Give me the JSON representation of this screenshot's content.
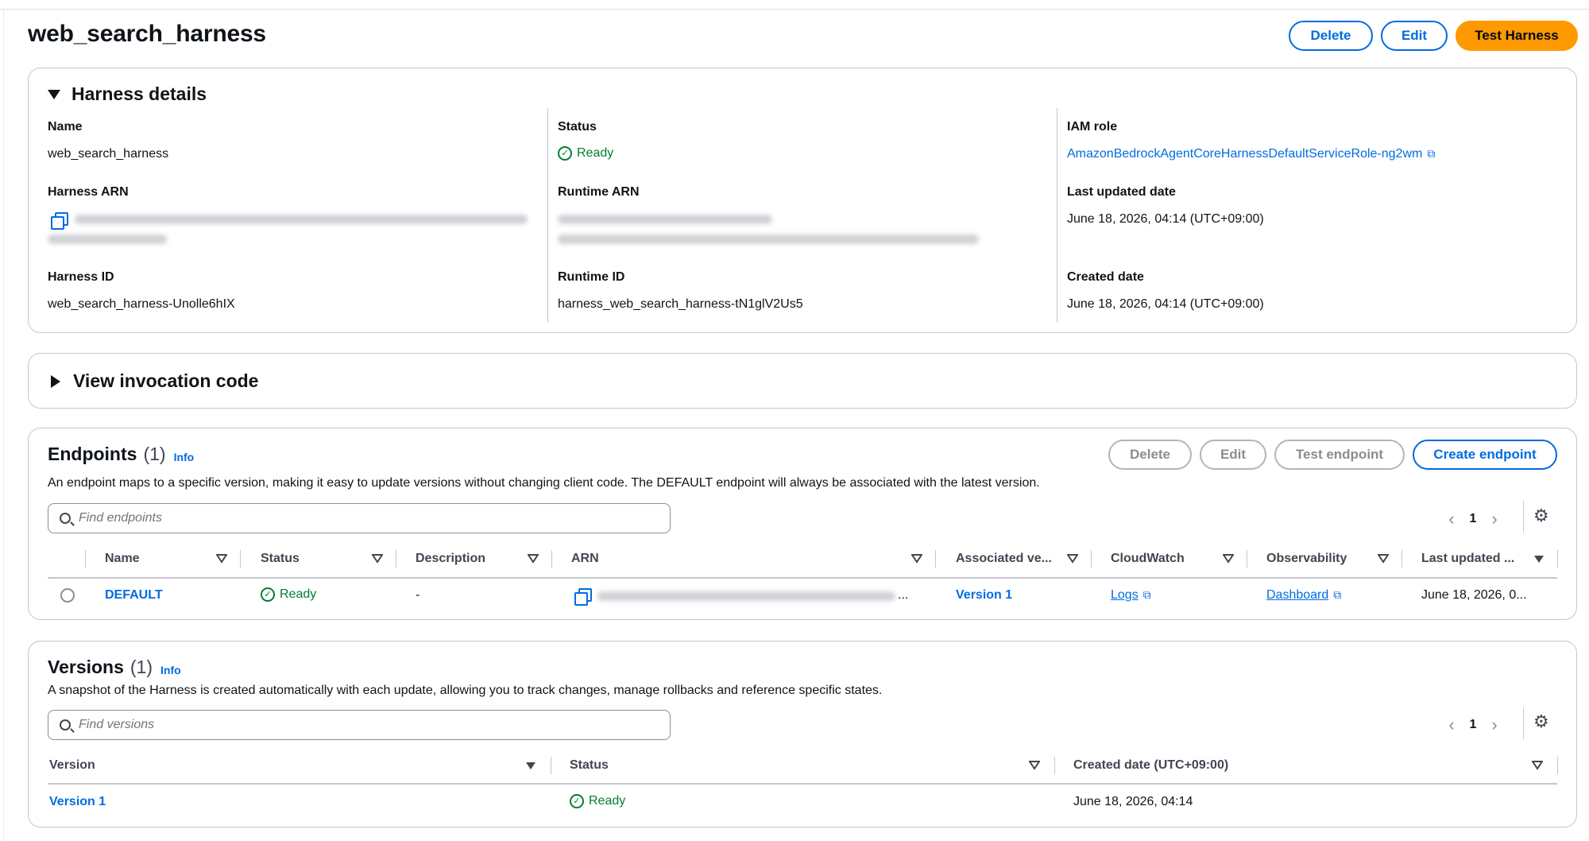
{
  "page": {
    "title": "web_search_harness",
    "buttons": {
      "delete": "Delete",
      "edit": "Edit",
      "test": "Test Harness"
    }
  },
  "details": {
    "heading": "Harness details",
    "name_label": "Name",
    "name_value": "web_search_harness",
    "status_label": "Status",
    "status_value": "Ready",
    "iam_label": "IAM role",
    "iam_value": "AmazonBedrockAgentCoreHarnessDefaultServiceRole-ng2wm",
    "harness_arn_label": "Harness ARN",
    "runtime_arn_label": "Runtime ARN",
    "last_updated_label": "Last updated date",
    "last_updated_value": "June 18, 2026, 04:14 (UTC+09:00)",
    "harness_id_label": "Harness ID",
    "harness_id_value": "web_search_harness-Unolle6hIX",
    "runtime_id_label": "Runtime ID",
    "runtime_id_value": "harness_web_search_harness-tN1glV2Us5",
    "created_label": "Created date",
    "created_value": "June 18, 2026, 04:14 (UTC+09:00)"
  },
  "invocation": {
    "heading": "View invocation code"
  },
  "endpoints": {
    "heading": "Endpoints",
    "count": "(1)",
    "info": "Info",
    "description": "An endpoint maps to a specific version, making it easy to update versions without changing client code. The DEFAULT endpoint will always be associated with the latest version.",
    "buttons": {
      "delete": "Delete",
      "edit": "Edit",
      "test": "Test endpoint",
      "create": "Create endpoint"
    },
    "search_placeholder": "Find endpoints",
    "page": "1",
    "columns": [
      "Name",
      "Status",
      "Description",
      "ARN",
      "Associated ve...",
      "CloudWatch",
      "Observability",
      "Last updated ..."
    ],
    "row": {
      "name": "DEFAULT",
      "status": "Ready",
      "description": "-",
      "arn_ellipsis": "...",
      "version": "Version 1",
      "cloudwatch": "Logs",
      "observability": "Dashboard",
      "last_updated": "June 18, 2026, 0..."
    }
  },
  "versions": {
    "heading": "Versions",
    "count": "(1)",
    "info": "Info",
    "description": "A snapshot of the Harness is created automatically with each update, allowing you to track changes, manage rollbacks and reference specific states.",
    "search_placeholder": "Find versions",
    "page": "1",
    "columns": [
      "Version",
      "Status",
      "Created date (UTC+09:00)"
    ],
    "row": {
      "version": "Version 1",
      "status": "Ready",
      "created": "June 18, 2026, 04:14"
    }
  },
  "colors": {
    "accent": "#006ce0",
    "primary_button": "#ff9900",
    "success": "#00802f",
    "border": "#c6c6cd"
  },
  "icons": [
    "copy-icon",
    "external-link-icon",
    "status-success-icon",
    "search-icon",
    "settings-gear-icon",
    "chevron-left-icon",
    "chevron-right-icon",
    "caret-down-icon",
    "caret-right-icon",
    "sort-icon"
  ]
}
